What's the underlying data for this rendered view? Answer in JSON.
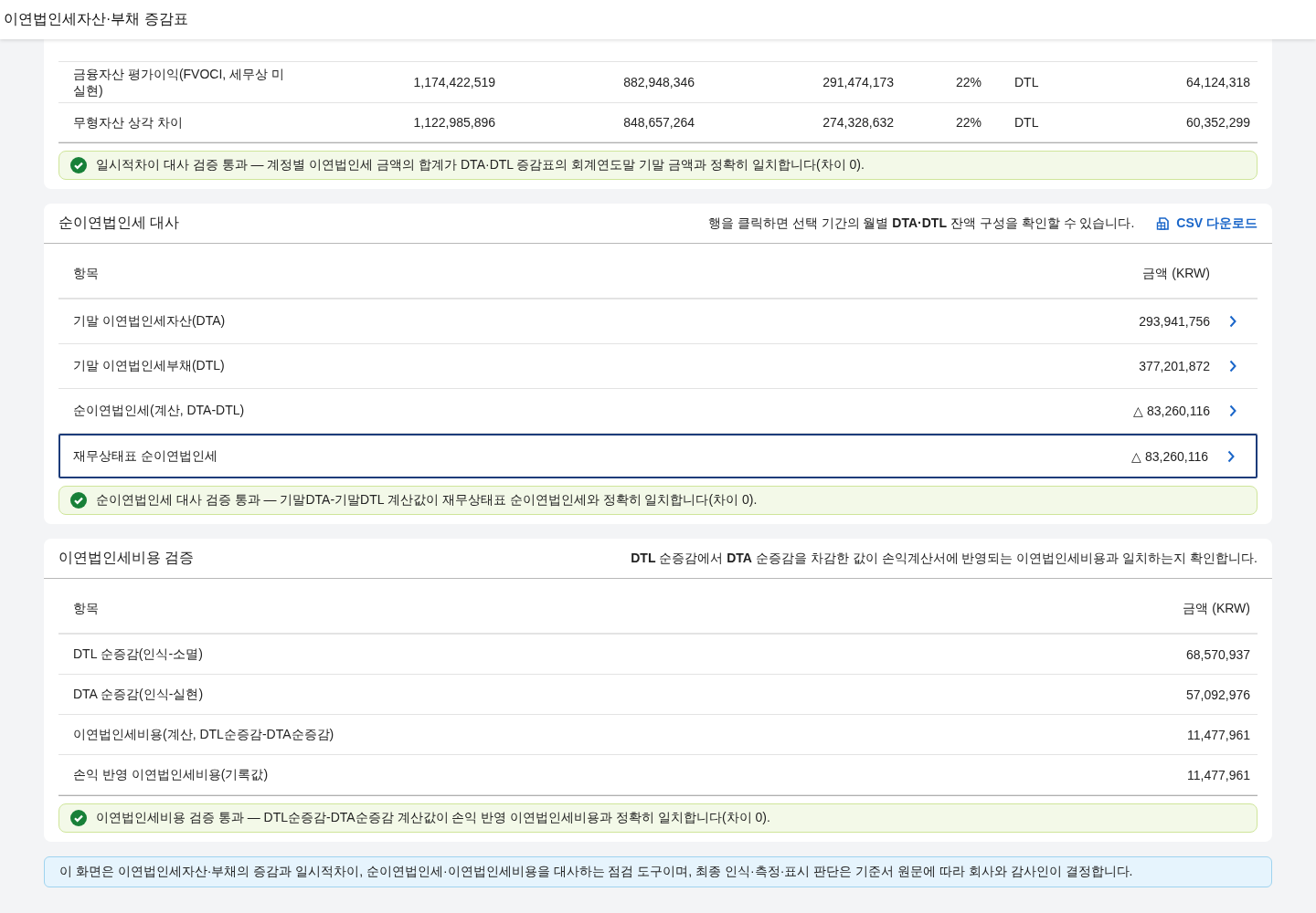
{
  "header": {
    "title": "이연법인세자산·부채 증감표"
  },
  "temp_diff": {
    "rows": [
      {
        "label": "금융자산 평가이익(FVOCI, 세무상 미실현)",
        "values": [
          "1,174,422,519",
          "882,948,346",
          "291,474,173"
        ],
        "rate": "22%",
        "type": "DTL",
        "amount": "64,124,318"
      },
      {
        "label": "무형자산 상각 차이",
        "values": [
          "1,122,985,896",
          "848,657,264",
          "274,328,632"
        ],
        "rate": "22%",
        "type": "DTL",
        "amount": "60,352,299"
      }
    ],
    "check": {
      "passed": true,
      "text": "일시적차이 대사 검증 통과 — 계정별 이연법인세 금액의 합계가 DTA·DTL 증감표의 회계연도말 기말 금액과 정확히 일치합니다(차이 0)."
    }
  },
  "net_recon": {
    "title": "순이연법인세 대사",
    "note": "행을 클릭하면 선택 기간의 월별 **DTA·DTL** 잔액 구성을 확인할 수 있습니다.",
    "download": "CSV 다운로드",
    "columns": [
      "항목",
      "금액 (KRW)"
    ],
    "rows": [
      {
        "label": "기말 이연법인세자산(DTA)",
        "amount": "293,941,756",
        "selected": false
      },
      {
        "label": "기말 이연법인세부채(DTL)",
        "amount": "377,201,872",
        "selected": false
      },
      {
        "label": "순이연법인세(계산, DTA-DTL)",
        "amount": "△ 83,260,116",
        "selected": false
      },
      {
        "label": "재무상태표 순이연법인세",
        "amount": "△ 83,260,116",
        "selected": true
      }
    ],
    "check": {
      "passed": true,
      "text": "순이연법인세 대사 검증 통과 — 기말DTA-기말DTL 계산값이 재무상태표 순이연법인세와 정확히 일치합니다(차이 0)."
    }
  },
  "expense_check": {
    "title": "이연법인세비용 검증",
    "note": "**DTL** 순증감에서 **DTA** 순증감을 차감한 값이 손익계산서에 반영되는 이연법인세비용과 일치하는지 확인합니다.",
    "columns": [
      "항목",
      "금액 (KRW)"
    ],
    "rows": [
      {
        "label": "DTL 순증감(인식-소멸)",
        "amount": "68,570,937"
      },
      {
        "label": "DTA 순증감(인식-실현)",
        "amount": "57,092,976"
      },
      {
        "label": "이연법인세비용(계산, DTL순증감-DTA순증감)",
        "amount": "11,477,961"
      },
      {
        "label": "손익 반영 이연법인세비용(기록값)",
        "amount": "11,477,961"
      }
    ],
    "check": {
      "passed": true,
      "text": "이연법인세비용 검증 통과 — DTL순증감-DTA순증감 계산값이 손익 반영 이연법인세비용과 정확히 일치합니다(차이 0)."
    }
  },
  "footer_note": "이 화면은 이연법인세자산·부채의 증감과 일시적차이, 순이연법인세·이연법인세비용을 대사하는 점검 도구이며, 최종 인식·측정·표시 판단은 기준서 원문에 따라 회사와 감사인이 결정합니다."
}
